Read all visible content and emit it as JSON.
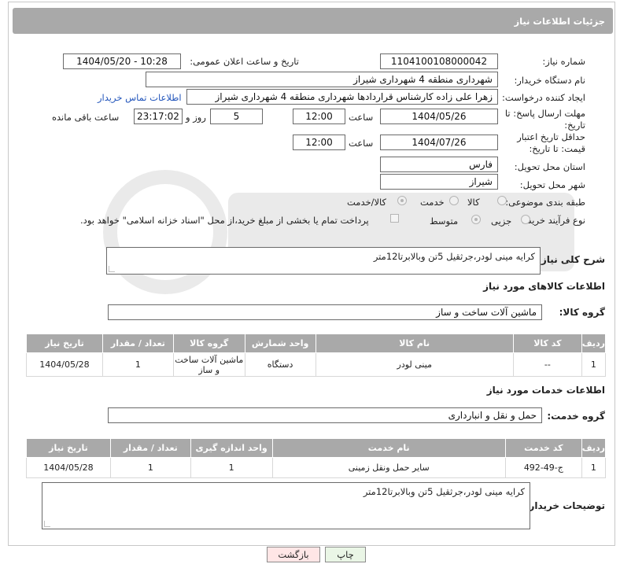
{
  "header": {
    "title": "جزئیات اطلاعات نیاز"
  },
  "labels": {
    "need_number": "شماره نیاز:",
    "announce_datetime": "تاریخ و ساعت اعلان عمومی:",
    "buyer_org": "نام دستگاه خریدار:",
    "creator": "ایجاد کننده درخواست:",
    "contact_link": "اطلاعات تماس خریدار",
    "reply_deadline": "مهلت ارسال پاسخ: تا تاریخ:",
    "time_word": "ساعت",
    "day_and": "روز و",
    "remaining": "ساعت باقی مانده",
    "price_validity": "حداقل تاریخ اعتبار قیمت: تا تاریخ:",
    "province": "استان محل تحویل:",
    "city": "شهر محل تحویل:",
    "category": "طبقه بندی موضوعی:",
    "process_type": "نوع فرآیند خرید :",
    "general_desc": "شرح کلی نیاز:",
    "goods_info": "اطلاعات کالاهای مورد نیاز",
    "goods_group": "گروه کالا:",
    "services_info": "اطلاعات خدمات مورد نیاز",
    "service_group": "گروه خدمت:",
    "buyer_notes": "توضیحات خریدار:"
  },
  "values": {
    "need_number": "1104100108000042",
    "announce_datetime": "1404/05/20 - 10:28",
    "buyer_org": "شهرداری منطقه 4 شهرداری شیراز",
    "creator": "زهرا علی زاده کارشناس قراردادها شهرداری منطقه 4 شهرداری شیراز",
    "reply_date": "1404/05/26",
    "reply_time": "12:00",
    "days": "5",
    "remaining_time": "23:17:02",
    "price_date": "1404/07/26",
    "price_time": "12:00",
    "province": "فارس",
    "city": "شیراز",
    "general_desc": "کرایه مینی لودر،جرثقیل 5تن وبالابرتا12متر",
    "goods_group": "ماشین آلات ساخت و ساز",
    "service_group": "حمل و نقل و انبارداری",
    "buyer_notes": "کرایه مینی لودر،جرثقیل 5تن وبالابرتا12متر"
  },
  "category_options": [
    "کالا",
    "خدمت",
    "کالا/خدمت"
  ],
  "category_selected": "کالا/خدمت",
  "process_options": [
    "جزیی",
    "متوسط"
  ],
  "process_selected": "متوسط",
  "payment_note": "پرداخت تمام یا بخشی از مبلغ خرید،از محل \"اسناد خزانه اسلامی\" خواهد بود.",
  "goods_table": {
    "headers": [
      "ردیف",
      "کد کالا",
      "نام کالا",
      "واحد شمارش",
      "گروه کالا",
      "تعداد / مقدار",
      "تاریخ نیاز"
    ],
    "rows": [
      [
        "1",
        "--",
        "مینی لودر",
        "دستگاه",
        "ماشین آلات ساخت و ساز",
        "1",
        "1404/05/28"
      ]
    ]
  },
  "services_table": {
    "headers": [
      "ردیف",
      "کد خدمت",
      "نام خدمت",
      "واحد اندازه گیری",
      "تعداد / مقدار",
      "تاریخ نیاز"
    ],
    "rows": [
      [
        "1",
        "ج-49-492",
        "سایر حمل ونقل زمینی",
        "1",
        "1",
        "1404/05/28"
      ]
    ]
  },
  "buttons": {
    "print": "چاپ",
    "back": "بازگشت"
  },
  "colors": {
    "header_bg": "#a9a9a9",
    "link": "#2255bb",
    "back_bg": "#ffe6e6",
    "print_bg": "#eaf6e6"
  }
}
